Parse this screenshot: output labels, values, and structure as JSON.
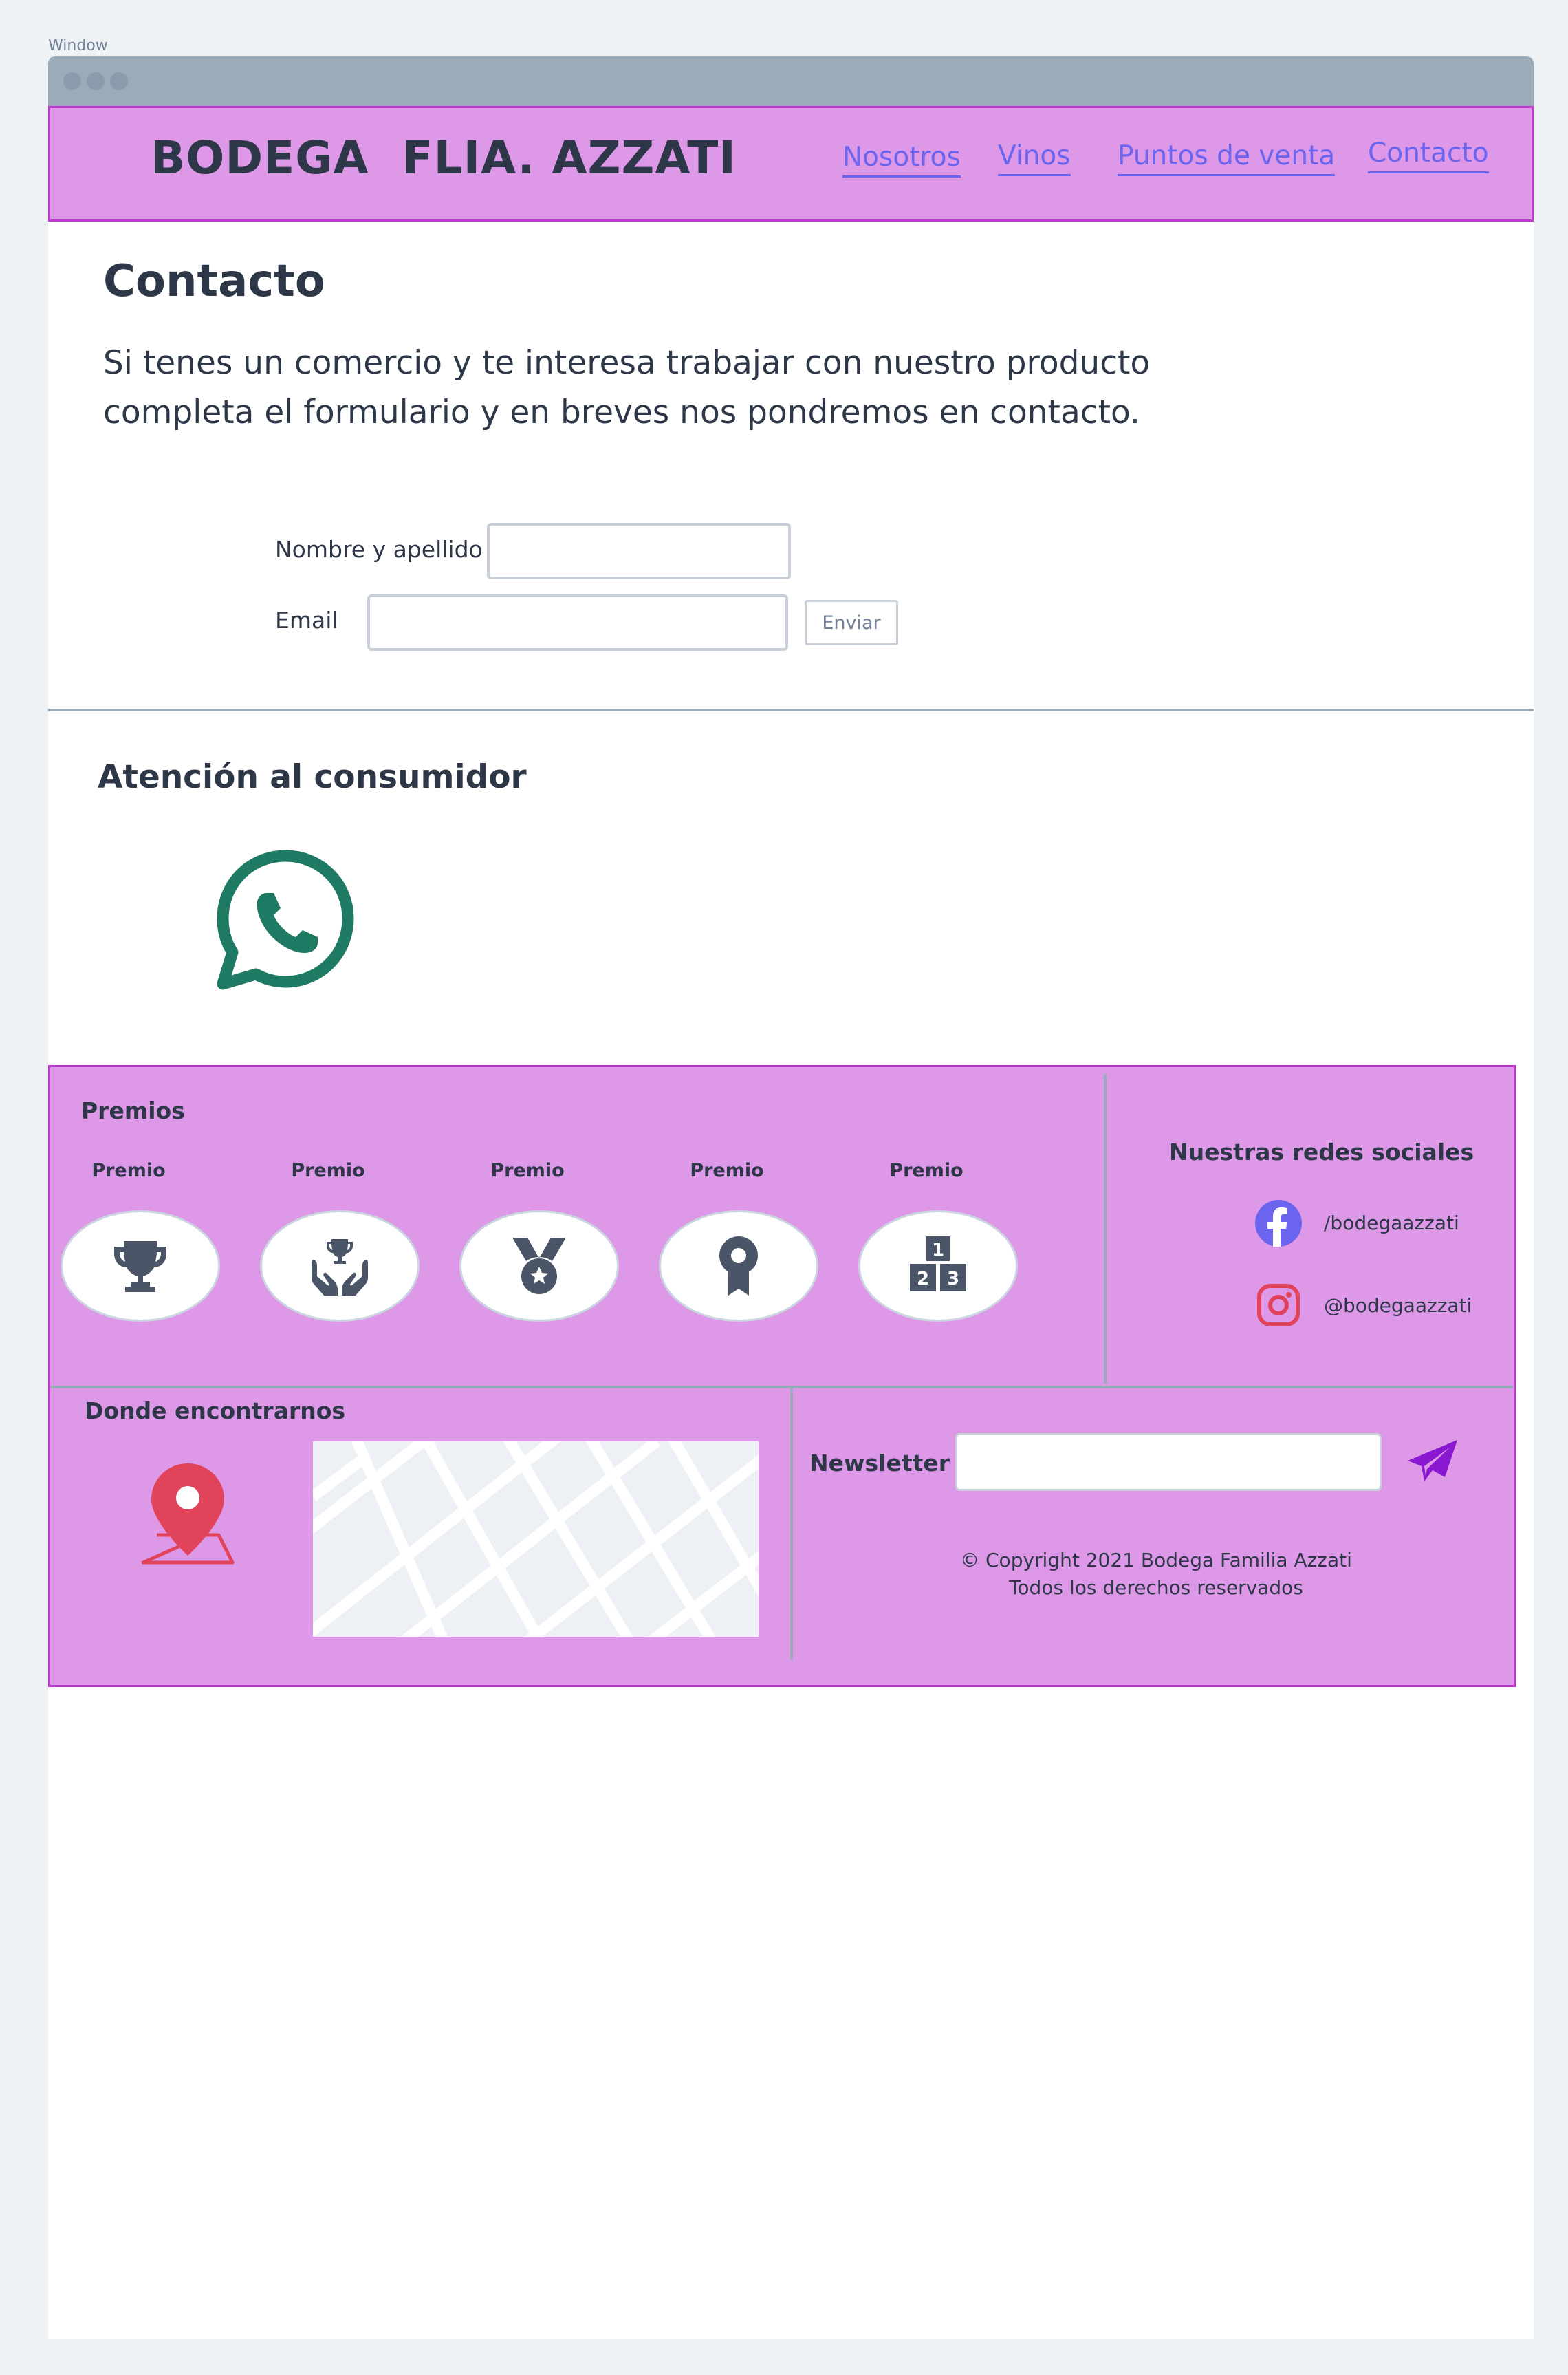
{
  "window": {
    "label": "Window"
  },
  "header": {
    "brand": "BODEGA  FLIA. AZZATI",
    "nav": [
      "Nosotros",
      "Vinos",
      "Puntos de venta",
      "Contacto"
    ]
  },
  "contact": {
    "title": "Contacto",
    "intro": "Si tenes un comercio y te interesa trabajar con nuestro producto completa el formulario y en breves nos pondremos en contacto.",
    "name_label": "Nombre y apellido",
    "name_value": "",
    "email_label": "Email",
    "email_value": "",
    "submit_label": "Enviar"
  },
  "consumer": {
    "title": "Atención al consumidor",
    "icon": "whatsapp-icon"
  },
  "footer": {
    "awards_title": "Premios",
    "awards": [
      {
        "label": "Premio",
        "icon": "trophy-icon"
      },
      {
        "label": "Premio",
        "icon": "trophy-hands-icon"
      },
      {
        "label": "Premio",
        "icon": "medal-icon"
      },
      {
        "label": "Premio",
        "icon": "ribbon-award-icon"
      },
      {
        "label": "Premio",
        "icon": "podium-icon"
      }
    ],
    "social_title": "Nuestras redes sociales",
    "facebook": "/bodegaazzati",
    "instagram": "@bodegaazzati",
    "location_title": "Donde encontrarnos",
    "newsletter_label": "Newsletter",
    "newsletter_value": "",
    "copyright_line1": "©  Copyright 2021 Bodega Familia Azzati",
    "copyright_line2": "Todos los derechos reservados"
  },
  "colors": {
    "header_bg": "#dd99e8",
    "header_border": "#c037d0",
    "link": "#6b64ee",
    "whatsapp": "#1e7a62",
    "facebook": "#6b64ee",
    "instagram": "#e0435a",
    "pin": "#e0435a",
    "send": "#8a18d0"
  }
}
